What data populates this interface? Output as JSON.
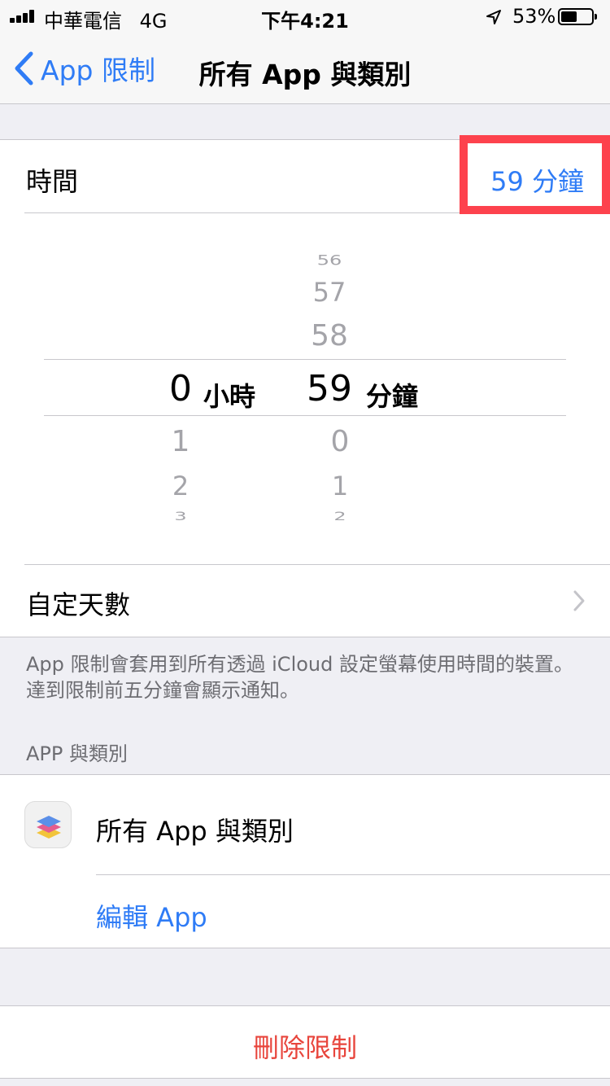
{
  "status_bar": {
    "carrier": "中華電信",
    "network": "4G",
    "time": "下午4:21",
    "battery_percent": "53%",
    "battery_level": 0.53,
    "location_icon": "location-arrow-icon"
  },
  "nav": {
    "back_label": "App 限制",
    "title": "所有 App 與類別"
  },
  "time_row": {
    "label": "時間",
    "value": "59 分鐘"
  },
  "picker": {
    "hours": {
      "above": [
        "",
        "",
        ""
      ],
      "selected": "0",
      "unit": "小時",
      "below": [
        "1",
        "2",
        "3"
      ]
    },
    "minutes": {
      "above": [
        "56",
        "57",
        "58"
      ],
      "selected": "59",
      "unit": "分鐘",
      "below": [
        "0",
        "1",
        "2"
      ]
    }
  },
  "custom_days": {
    "label": "自定天數"
  },
  "footer_note": "App 限制會套用到所有透過 iCloud 設定螢幕使用時間的裝置。達到限制前五分鐘會顯示通知。",
  "apps_section": {
    "header": "APP 與類別",
    "item_label": "所有 App 與類別",
    "edit_label": "編輯 App"
  },
  "delete": {
    "label": "刪除限制"
  },
  "colors": {
    "accent": "#2f7cf6",
    "destructive": "#e8453c",
    "highlight": "#fd424d"
  }
}
